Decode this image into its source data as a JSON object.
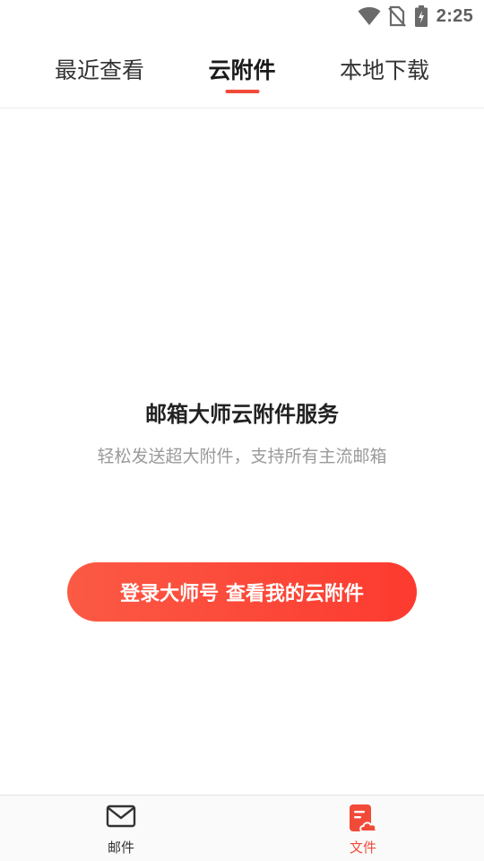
{
  "status_bar": {
    "time": "2:25",
    "icons": [
      "wifi-icon",
      "no-sim-icon",
      "battery-charging-icon"
    ]
  },
  "tabs": [
    {
      "label": "最近查看",
      "active": false
    },
    {
      "label": "云附件",
      "active": true
    },
    {
      "label": "本地下载",
      "active": false
    }
  ],
  "empty_state": {
    "title": "邮箱大师云附件服务",
    "subtitle": "轻松发送超大附件，支持所有主流邮箱",
    "button_label": "登录大师号 查看我的云附件"
  },
  "bottom_nav": {
    "items": [
      {
        "label": "邮件",
        "icon": "mail-icon",
        "active": false
      },
      {
        "label": "文件",
        "icon": "file-cloud-icon",
        "active": true
      }
    ]
  },
  "colors": {
    "accent": "#f24a39",
    "button_gradient_start": "#fb5a45",
    "button_gradient_end": "#fd3a2f",
    "subtitle": "#9a9a9a"
  }
}
